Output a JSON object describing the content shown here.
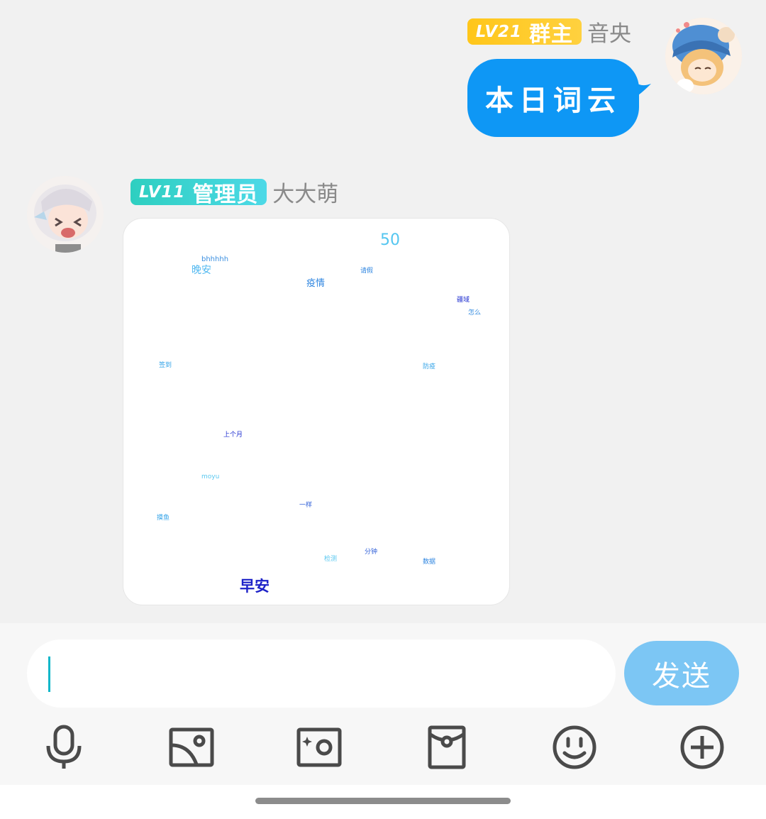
{
  "messages": {
    "outgoing": {
      "badge_level": "LV21",
      "badge_role": "群主",
      "nickname": "音央",
      "text": "本日词云"
    },
    "incoming": {
      "badge_level": "LV11",
      "badge_role": "管理员",
      "nickname": "大大萌",
      "wordcloud": [
        {
          "text": "50"
        },
        {
          "text": "bhhhhh"
        },
        {
          "text": "晚安"
        },
        {
          "text": "疫情"
        },
        {
          "text": "请假"
        },
        {
          "text": "疆域"
        },
        {
          "text": "怎么"
        },
        {
          "text": "签到"
        },
        {
          "text": "防疫"
        },
        {
          "text": "上个月"
        },
        {
          "text": "moyu"
        },
        {
          "text": "一样"
        },
        {
          "text": "摸鱼"
        },
        {
          "text": "检测"
        },
        {
          "text": "分钟"
        },
        {
          "text": "数据"
        },
        {
          "text": "早安"
        }
      ]
    }
  },
  "composer": {
    "input_value": "",
    "send_label": "发送"
  },
  "icons": {
    "toolbar": [
      "microphone-icon",
      "image-icon",
      "camera-icon",
      "red-packet-icon",
      "emoji-icon",
      "plus-icon"
    ]
  },
  "colors": {
    "accent_blue": "#0e97f5",
    "owner_badge": "#ffc61a",
    "admin_badge": "#2ecfc0",
    "send_button": "#7cc6f4"
  }
}
